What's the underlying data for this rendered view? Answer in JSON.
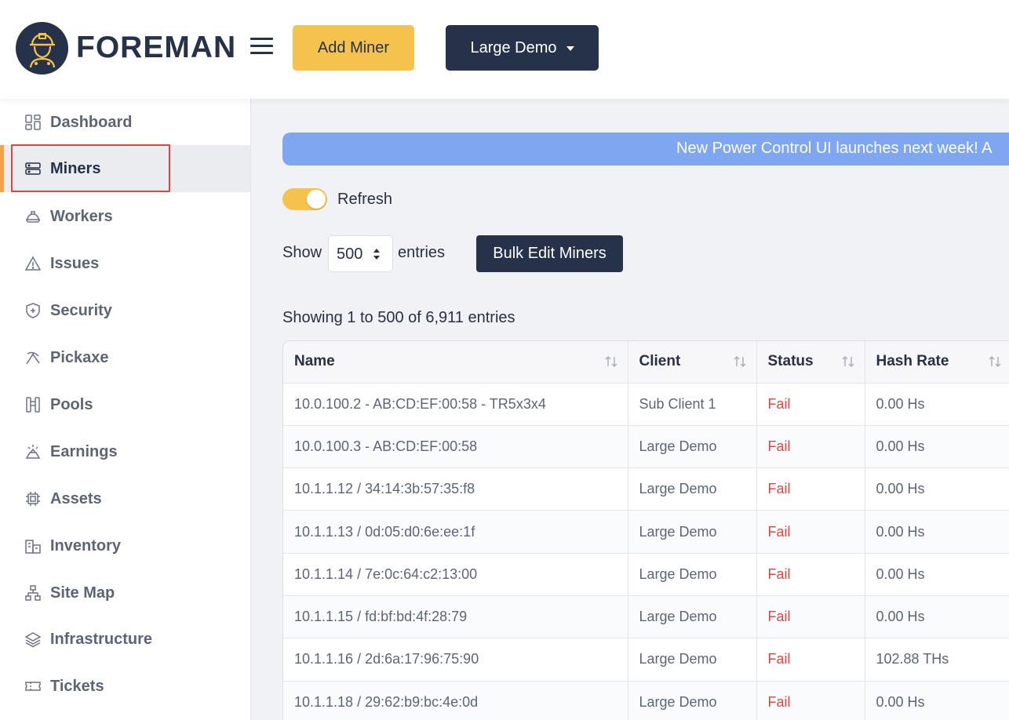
{
  "header": {
    "brand": "FOREMAN",
    "add_miner_label": "Add Miner",
    "client_select_label": "Large Demo"
  },
  "sidebar": {
    "items": [
      {
        "label": "Dashboard",
        "icon": "dashboard-icon"
      },
      {
        "label": "Miners",
        "icon": "server-icon",
        "active": true
      },
      {
        "label": "Workers",
        "icon": "hardhat-icon"
      },
      {
        "label": "Issues",
        "icon": "warning-icon"
      },
      {
        "label": "Security",
        "icon": "shield-icon"
      },
      {
        "label": "Pickaxe",
        "icon": "pickaxe-icon"
      },
      {
        "label": "Pools",
        "icon": "pools-icon"
      },
      {
        "label": "Earnings",
        "icon": "earnings-icon"
      },
      {
        "label": "Assets",
        "icon": "chip-icon"
      },
      {
        "label": "Inventory",
        "icon": "inventory-icon"
      },
      {
        "label": "Site Map",
        "icon": "sitemap-icon"
      },
      {
        "label": "Infrastructure",
        "icon": "layers-icon"
      },
      {
        "label": "Tickets",
        "icon": "ticket-icon"
      }
    ]
  },
  "main": {
    "banner_text": "New Power Control UI launches next week! A",
    "refresh_label": "Refresh",
    "refresh_on": true,
    "show_label": "Show",
    "entries_value": "500",
    "entries_label": "entries",
    "bulk_edit_label": "Bulk Edit Miners",
    "showing_text": "Showing 1 to 500 of 6,911 entries"
  },
  "table": {
    "columns": [
      "Name",
      "Client",
      "Status",
      "Hash Rate"
    ],
    "rows": [
      [
        "10.0.100.2 - AB:CD:EF:00:58 - TR5x3x4",
        "Sub Client 1",
        "Fail",
        "0.00 Hs"
      ],
      [
        "10.0.100.3 - AB:CD:EF:00:58",
        "Large Demo",
        "Fail",
        "0.00 Hs"
      ],
      [
        "10.1.1.12 / 34:14:3b:57:35:f8",
        "Large Demo",
        "Fail",
        "0.00 Hs"
      ],
      [
        "10.1.1.13 / 0d:05:d0:6e:ee:1f",
        "Large Demo",
        "Fail",
        "0.00 Hs"
      ],
      [
        "10.1.1.14 / 7e:0c:64:c2:13:00",
        "Large Demo",
        "Fail",
        "0.00 Hs"
      ],
      [
        "10.1.1.15 / fd:bf:bd:4f:28:79",
        "Large Demo",
        "Fail",
        "0.00 Hs"
      ],
      [
        "10.1.1.16 / 2d:6a:17:96:75:90",
        "Large Demo",
        "Fail",
        "102.88 THs"
      ],
      [
        "10.1.1.18 / 29:62:b9:bc:4e:0d",
        "Large Demo",
        "Fail",
        "0.00 Hs"
      ]
    ]
  },
  "colors": {
    "brand_navy": "#263249",
    "accent_yellow": "#f5c34d",
    "banner_blue": "#7fa6f0",
    "fail_red": "#e0443f",
    "active_bar": "#f5a14a"
  }
}
